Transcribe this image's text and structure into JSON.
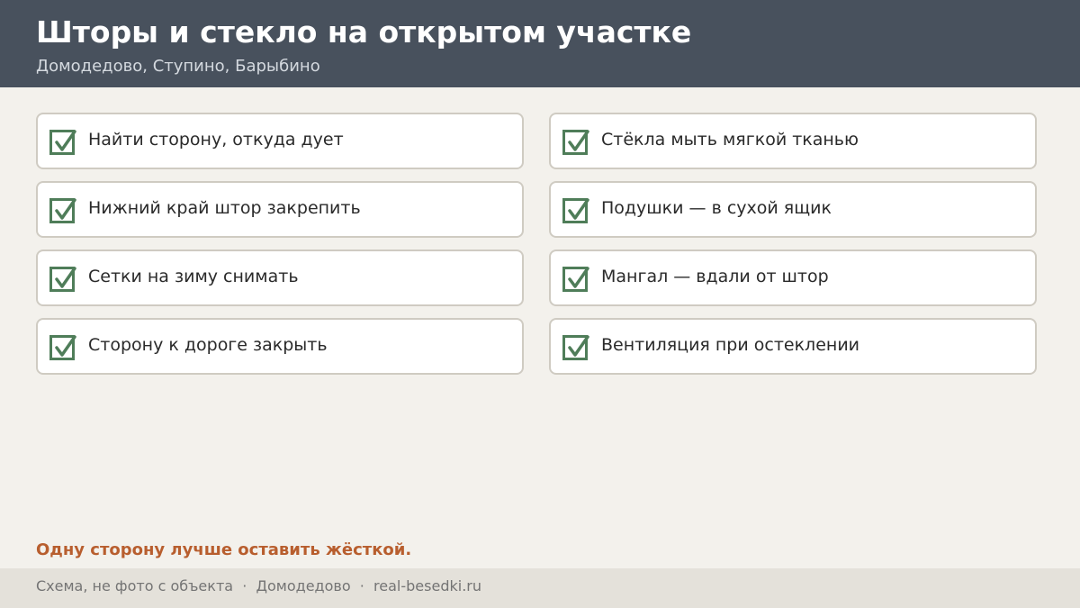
{
  "header": {
    "title": "Шторы и стекло на открытом участке",
    "subtitle": "Домодедово, Ступино, Барыбино"
  },
  "checklist": {
    "left": [
      {
        "label": "Найти сторону, откуда дует",
        "checked": true
      },
      {
        "label": "Нижний край штор закрепить",
        "checked": true
      },
      {
        "label": "Сетки на зиму снимать",
        "checked": true
      },
      {
        "label": "Сторону к дороге закрыть",
        "checked": true
      }
    ],
    "right": [
      {
        "label": "Стёкла мыть мягкой тканью",
        "checked": true
      },
      {
        "label": "Подушки — в сухой ящик",
        "checked": true
      },
      {
        "label": "Мангал — вдали от штор",
        "checked": true
      },
      {
        "label": "Вентиляция при остеклении",
        "checked": true
      }
    ]
  },
  "note": "Одну сторону лучше оставить жёсткой.",
  "footer": {
    "text": "Схема, не фото с объекта  ·  Домодедово  ·  real-besedki.ru"
  },
  "colors": {
    "header_bg": "#48515d",
    "check_green": "#4f7d59",
    "note_orange": "#b85e2e",
    "page_bg": "#f3f1ec",
    "footer_bg": "#e4e1da"
  },
  "icons": {
    "check": "checkbox-checked-icon"
  }
}
